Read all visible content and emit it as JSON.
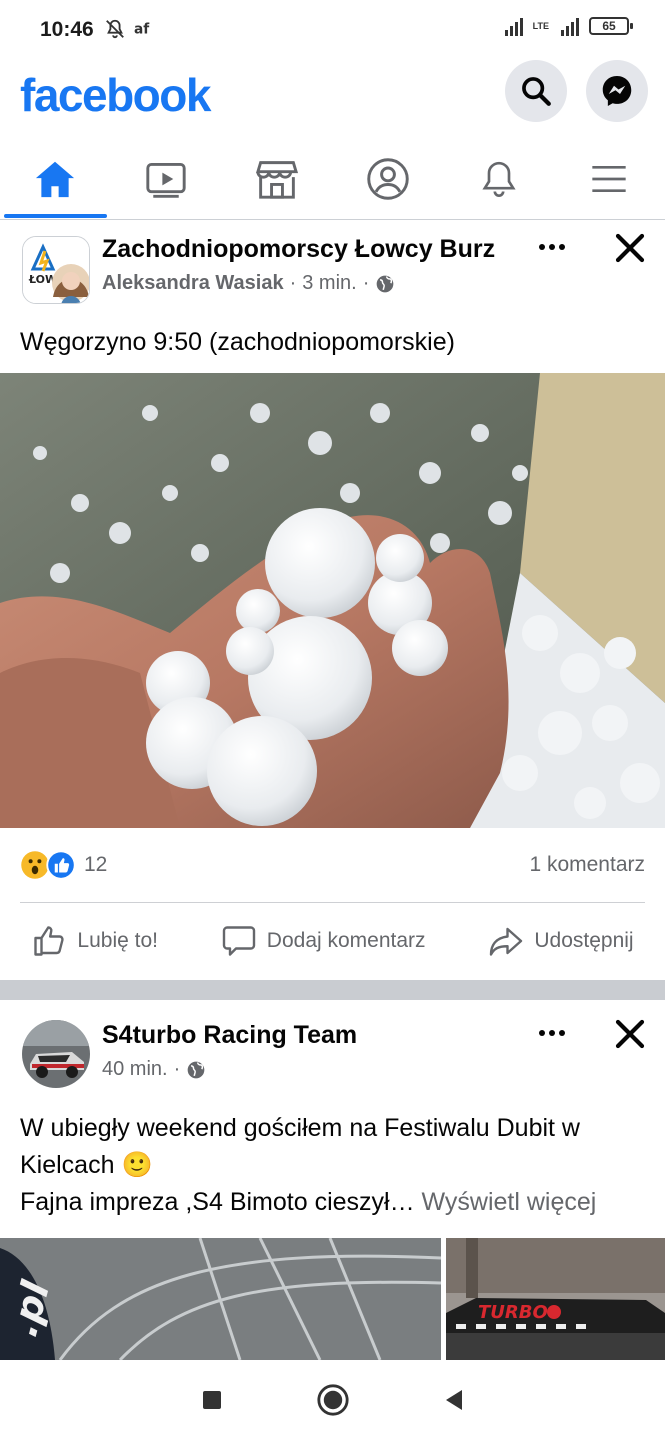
{
  "status_bar": {
    "time": "10:46",
    "battery": "65",
    "network": "LTE"
  },
  "header": {
    "logo": "facebook",
    "buttons": [
      {
        "name": "search-button",
        "icon": "search-icon"
      },
      {
        "name": "messenger-button",
        "icon": "messenger-icon"
      }
    ]
  },
  "nav": {
    "tabs": [
      {
        "name": "home",
        "icon": "home-icon",
        "active": true
      },
      {
        "name": "watch",
        "icon": "video-icon",
        "active": false
      },
      {
        "name": "marketplace",
        "icon": "store-icon",
        "active": false
      },
      {
        "name": "profile",
        "icon": "profile-icon",
        "active": false
      },
      {
        "name": "notifications",
        "icon": "bell-icon",
        "active": false
      },
      {
        "name": "menu",
        "icon": "hamburger-menu-icon",
        "active": false
      }
    ]
  },
  "posts": [
    {
      "page_name": "Zachodniopomorscy Łowcy Burz",
      "author": "Aleksandra Wasiak",
      "time": "3 min.",
      "separator": "·",
      "text": "Węgorzyno 9:50 (zachodniopomorskie)",
      "avatar_logo_text": "ŁOW",
      "reaction_count": "12",
      "comments": "1 komentarz",
      "actions": {
        "like": "Lubię to!",
        "comment": "Dodaj komentarz",
        "share": "Udostępnij"
      },
      "colors": {
        "like": "#1877f2",
        "wow": "#f7b928"
      }
    },
    {
      "page_name": "S4turbo Racing Team",
      "time": "40 min.",
      "separator": "·",
      "text_line1": "W ubiegły weekend gościłem na Festiwalu Dubit w Kielcach 🙂",
      "text_line2": "Fajna impreza ,S4 Bimoto cieszył…",
      "see_more": "Wyświetl więcej",
      "image_text_left": ".pl",
      "image_text_right": "TURBO"
    }
  ],
  "android_nav": {
    "buttons": [
      "recents-icon",
      "home-circle-icon",
      "back-icon"
    ]
  }
}
